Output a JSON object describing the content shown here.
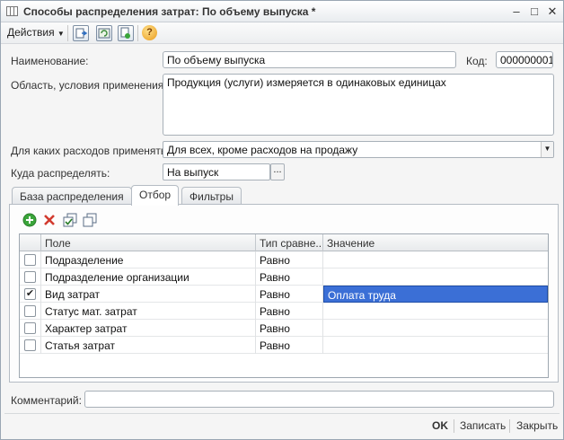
{
  "window": {
    "title": "Способы распределения затрат: По объему выпуска *"
  },
  "toolbar": {
    "actions_label": "Действия",
    "help_glyph": "?"
  },
  "form": {
    "name_label": "Наименование:",
    "name_value": "По объему выпуска",
    "code_label": "Код:",
    "code_value": "000000001",
    "scope_label": "Область, условия применения:",
    "scope_value": "Продукция (услуги) измеряется в одинаковых единицах",
    "expenses_label": "Для каких расходов применять:",
    "expenses_value": "Для всех, кроме расходов на продажу",
    "distribute_label": "Куда распределять:",
    "distribute_value": "На выпуск",
    "distribute_button": "...",
    "comment_label": "Комментарий:",
    "comment_value": ""
  },
  "tabs": [
    {
      "label": "База распределения"
    },
    {
      "label": "Отбор"
    },
    {
      "label": "Фильтры"
    }
  ],
  "grid": {
    "columns": [
      "Поле",
      "Тип сравне...",
      "Значение"
    ],
    "rows": [
      {
        "checked": false,
        "field": "Подразделение",
        "comparison": "Равно",
        "value": ""
      },
      {
        "checked": false,
        "field": "Подразделение организации",
        "comparison": "Равно",
        "value": ""
      },
      {
        "checked": true,
        "field": "Вид затрат",
        "comparison": "Равно",
        "value": "Оплата труда"
      },
      {
        "checked": false,
        "field": "Статус мат. затрат",
        "comparison": "Равно",
        "value": ""
      },
      {
        "checked": false,
        "field": "Характер затрат",
        "comparison": "Равно",
        "value": ""
      },
      {
        "checked": false,
        "field": "Статья затрат",
        "comparison": "Равно",
        "value": ""
      }
    ]
  },
  "footer": {
    "ok_label": "OK",
    "save_label": "Записать",
    "close_label": "Закрыть"
  },
  "colors": {
    "selection": "#3b6fd6",
    "add_icon": "#3aa53a",
    "delete_icon": "#d23b2f"
  }
}
